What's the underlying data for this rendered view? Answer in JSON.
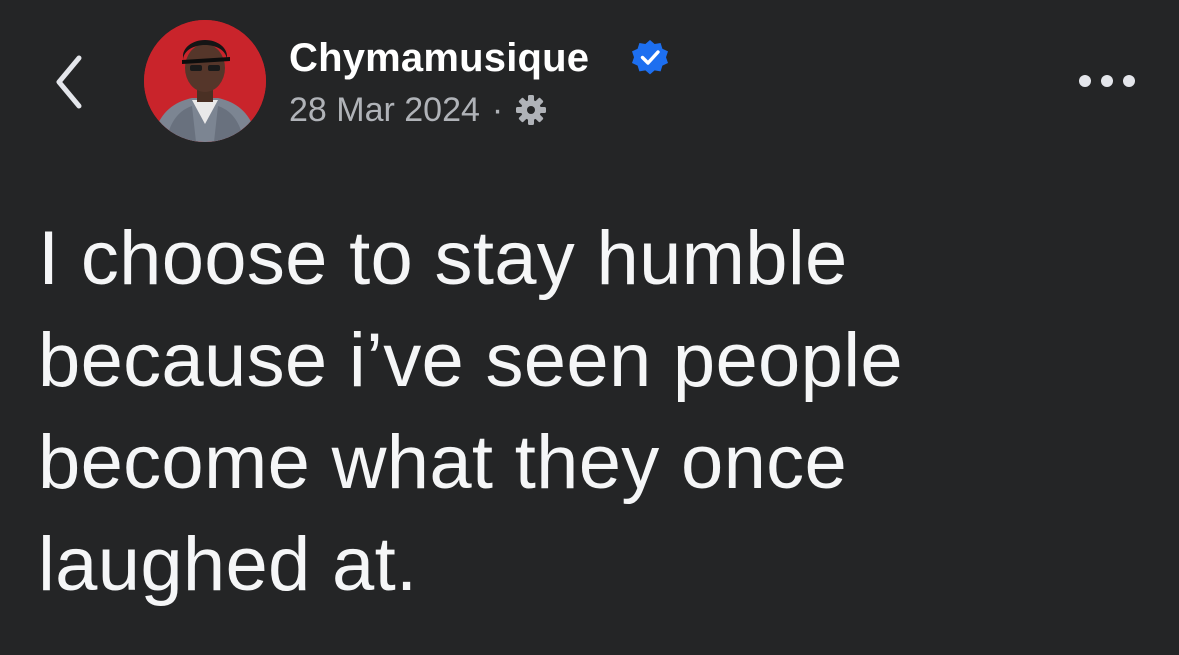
{
  "header": {
    "back_icon": "chevron-left-icon",
    "author_name": "Chymamusique",
    "verified_icon": "verified-badge-icon",
    "date": "28 Mar 2024",
    "separator": "·",
    "privacy_icon": "gear-icon",
    "more_icon": "ellipsis-icon"
  },
  "post": {
    "lines": [
      "I choose to stay humble",
      "because i’ve seen people",
      "become what they once",
      "laughed at."
    ]
  },
  "colors": {
    "background": "#242526",
    "text_primary": "#ffffff",
    "text_secondary": "#b0b3b8",
    "verified_blue": "#1d6ff0",
    "avatar_bg": "#c9242b"
  }
}
